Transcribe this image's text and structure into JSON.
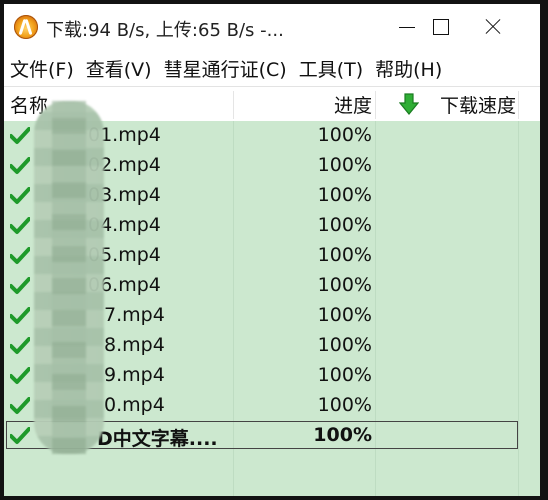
{
  "window": {
    "title": "下载:94 B/s, 上传:65 B/s -..."
  },
  "menubar": [
    {
      "label": "文件(F)"
    },
    {
      "label": "查看(V)"
    },
    {
      "label": "彗星通行证(C)"
    },
    {
      "label": "工具(T)"
    },
    {
      "label": "帮助(H)"
    }
  ],
  "columns": {
    "name": "名称",
    "progress": "进度",
    "speed": "下载速度"
  },
  "rows": [
    {
      "name": "01.mp4",
      "progress": "100%",
      "status": "complete"
    },
    {
      "name": "02.mp4",
      "progress": "100%",
      "status": "complete"
    },
    {
      "name": "03.mp4",
      "progress": "100%",
      "status": "complete"
    },
    {
      "name": "04.mp4",
      "progress": "100%",
      "status": "complete"
    },
    {
      "name": "05.mp4",
      "progress": "100%",
      "status": "complete"
    },
    {
      "name": "06.mp4",
      "progress": "100%",
      "status": "complete"
    },
    {
      "name": "7.mp4",
      "progress": "100%",
      "status": "complete"
    },
    {
      "name": "8.mp4",
      "progress": "100%",
      "status": "complete"
    },
    {
      "name": "9.mp4",
      "progress": "100%",
      "status": "complete"
    },
    {
      "name": "0.mp4",
      "progress": "100%",
      "status": "complete"
    },
    {
      "name": "D中文字幕....",
      "progress": "100%",
      "status": "complete",
      "selected": true
    }
  ],
  "colors": {
    "list_background": "#cce8cf",
    "check": "#1e9a2a",
    "title_icon": "#f2a21b"
  }
}
